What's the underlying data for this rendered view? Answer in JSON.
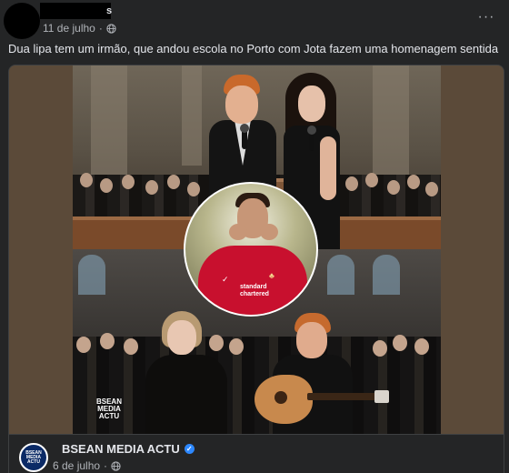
{
  "post": {
    "author_visible_fragment": "s",
    "date": "11 de julho",
    "separator": "·",
    "more_label": "···",
    "caption": "Dua lipa tem um irmão, que andou escola no Porto com Jota fazem uma homenagem sentida"
  },
  "image": {
    "watermark_line1": "BSEAN",
    "watermark_line2": "MEDIA",
    "watermark_line3": "ACTU",
    "inset_shirt_brand": "✓",
    "inset_sponsor_line1": "standard",
    "inset_sponsor_line2": "chartered",
    "inset_crest": "♣"
  },
  "shared_post": {
    "page_name": "BSEAN MEDIA ACTU",
    "verified_mark": "✓",
    "date": "6 de julho",
    "separator": "·",
    "avatar_line1": "BSEAN",
    "avatar_line2": "MEDIA",
    "avatar_line3": "ACTU"
  },
  "colors": {
    "background": "#242526",
    "text_primary": "#e4e6eb",
    "text_secondary": "#b0b3b8",
    "verified": "#2d88ff",
    "jersey_red": "#c8102e"
  },
  "icons": {
    "privacy": "globe-icon",
    "menu": "more-horizontal-icon",
    "verified": "verified-badge-icon"
  }
}
